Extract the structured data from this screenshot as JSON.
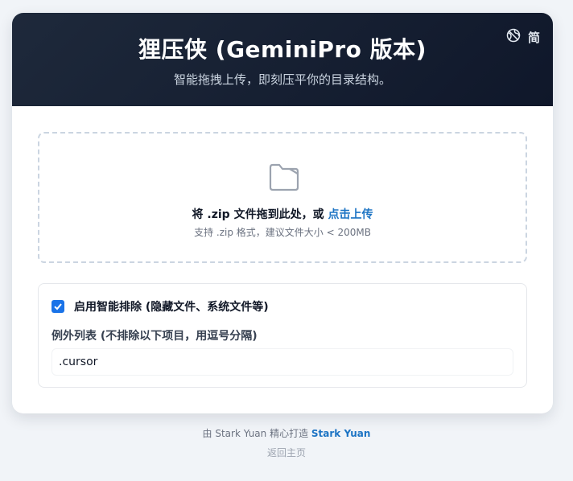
{
  "header": {
    "title": "狸压侠 (GeminiPro 版本)",
    "subtitle": "智能拖拽上传，即刻压平你的目录结构。",
    "lang_label": "简",
    "lang_icon": "globe-icon"
  },
  "dropzone": {
    "icon": "folder-icon",
    "main_text": "将 .zip 文件拖到此处，或 ",
    "link_text": "点击上传",
    "hint": "支持 .zip 格式，建议文件大小 < 200MB"
  },
  "options": {
    "smart_exclude_label": "启用智能排除 (隐藏文件、系统文件等)",
    "smart_exclude_checked": true,
    "exceptions_label": "例外列表 (不排除以下项目，用逗号分隔)",
    "exceptions_value": ".cursor"
  },
  "footer": {
    "made_by": "由 Stark Yuan 精心打造 ",
    "author": "Stark Yuan",
    "back_home": "返回主页"
  },
  "colors": {
    "header_bg": "#0f172a",
    "accent": "#1d74c4",
    "checkbox": "#1a73e8"
  }
}
